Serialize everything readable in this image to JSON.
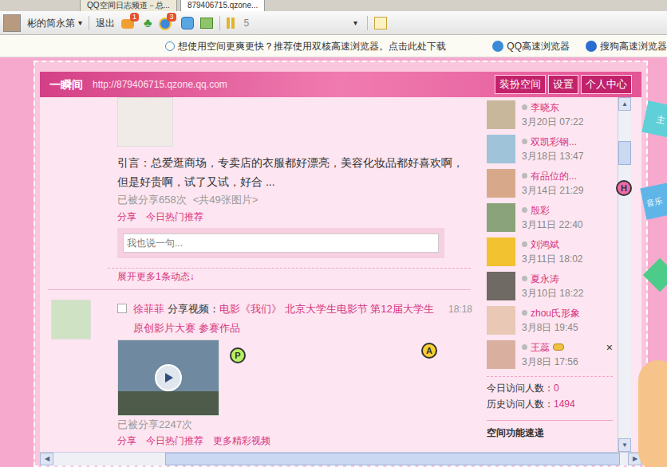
{
  "browser_tabs": [
    {
      "label": "QQ空间日志频道－总...",
      "selected": false
    },
    {
      "label": "879406715.qzone...",
      "selected": true
    }
  ],
  "toolbar": {
    "user": "彬的简永第",
    "user_caret": "▾",
    "logout": "退出",
    "badges": [
      "1",
      "3"
    ],
    "counter": "5",
    "caret": "▾"
  },
  "notice": {
    "text": "想使用空间更爽更快？推荐使用双核高速浏览器。点击此处下载",
    "links": [
      "QQ高速浏览器",
      "搜狗高速浏览器"
    ]
  },
  "space": {
    "title": "一瞬间",
    "url": "http://879406715.qzone.qq.com",
    "buttons": [
      "装扮空间",
      "设置",
      "个人中心"
    ]
  },
  "feed": {
    "blog": {
      "intro": "引言：总爱逛商场，专卖店的衣服都好漂亮，美容化妆品都好喜欢啊，但是好贵啊，试了又试，好合 ...",
      "shared": "已被分享658次",
      "pics": "<共49张图片>",
      "actions": [
        "分享",
        "今日热门推荐"
      ],
      "comment_placeholder": "我也说一句..."
    },
    "expand": "展开更多1条动态↓",
    "post": {
      "author": "徐菲菲",
      "verb": "分享视频：",
      "title": "电影《我们》 北京大学生电影节 第12届大学生原创影片大赛 参赛作品",
      "time": "18:18",
      "shared": "已被分享2247次",
      "actions": [
        "分享",
        "今日热门推荐",
        "更多精彩视频"
      ]
    }
  },
  "visitors": [
    {
      "name": "李晓东",
      "time": "3月20日 07:22",
      "vip": false,
      "hovered": false
    },
    {
      "name": "双凯彩钢...",
      "time": "3月18日 13:47",
      "vip": false,
      "hovered": false
    },
    {
      "name": "有品位的...",
      "time": "3月14日 21:29",
      "vip": false,
      "hovered": false
    },
    {
      "name": "殷彩",
      "time": "3月11日 22:40",
      "vip": false,
      "hovered": false
    },
    {
      "name": "刘鸿斌",
      "time": "3月11日 18:02",
      "vip": false,
      "hovered": false
    },
    {
      "name": "夏永涛",
      "time": "3月10日 18:22",
      "vip": false,
      "hovered": false
    },
    {
      "name": "zhou氏形象",
      "time": "3月8日 19:45",
      "vip": false,
      "hovered": false
    },
    {
      "name": "王蕊",
      "time": "3月8日 17:56",
      "vip": true,
      "hovered": true
    }
  ],
  "visitor_close": "×",
  "stats": [
    {
      "label": "今日访问人数：",
      "value": "0"
    },
    {
      "label": "历史访问人数：",
      "value": "1494"
    }
  ],
  "section_title": "空间功能速递",
  "markers": [
    "P",
    "A",
    "H"
  ],
  "decorations": [
    "主",
    "音乐"
  ]
}
